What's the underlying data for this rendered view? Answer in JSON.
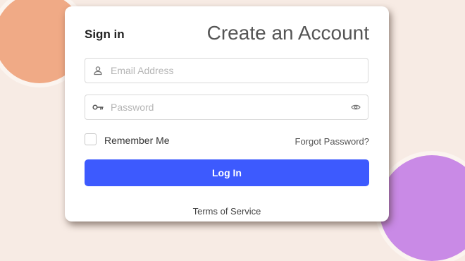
{
  "colors": {
    "accent": "#3d5afe",
    "blob_orange": "#f0aa86",
    "blob_purple": "#c98ae6",
    "background": "#f7ebe4"
  },
  "header": {
    "signin_label": "Sign in",
    "create_account_title": "Create an Account"
  },
  "form": {
    "email": {
      "icon": "user-icon",
      "placeholder": "Email Address",
      "value": ""
    },
    "password": {
      "icon": "key-icon",
      "placeholder": "Password",
      "value": "",
      "toggle_icon": "eye-icon"
    },
    "remember_label": "Remember Me",
    "remember_checked": false,
    "forgot_label": "Forgot Password?",
    "login_label": "Log In"
  },
  "footer": {
    "terms_label": "Terms of Service"
  }
}
